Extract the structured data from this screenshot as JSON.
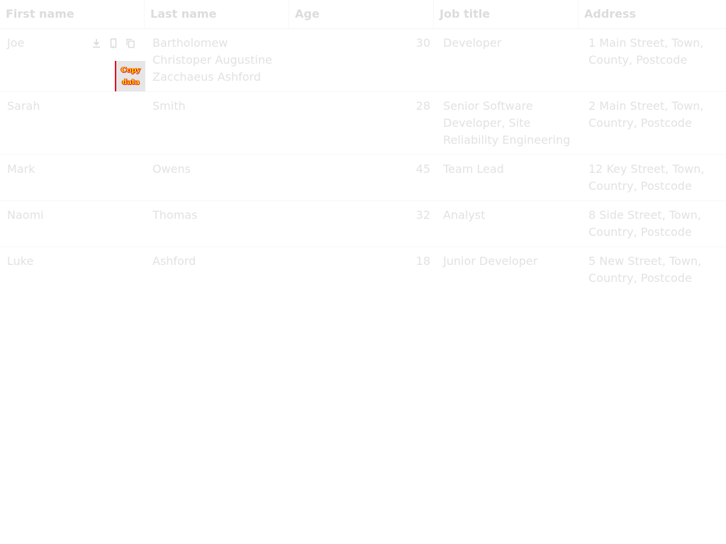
{
  "columns": [
    "First name",
    "Last name",
    "Age",
    "Job title",
    "Address"
  ],
  "rows": [
    {
      "first": "Joe",
      "last": "Bartholomew Christoper Augustine Zacchaeus Ashford",
      "age": "30",
      "job": "Developer",
      "address": "1 Main Street, Town, County, Postcode"
    },
    {
      "first": "Sarah",
      "last": "Smith",
      "age": "28",
      "job": "Senior Software Developer, Site Reliability Engineering",
      "address": "2 Main Street, Town, Country, Postcode"
    },
    {
      "first": "Mark",
      "last": "Owens",
      "age": "45",
      "job": "Team Lead",
      "address": "12 Key Street, Town, Country, Postcode"
    },
    {
      "first": "Naomi",
      "last": "Thomas",
      "age": "32",
      "job": "Analyst",
      "address": "8 Side Street, Town, Country, Postcode"
    },
    {
      "first": "Luke",
      "last": "Ashford",
      "age": "18",
      "job": "Junior Developer",
      "address": "5 New Street, Town, Country, Postcode"
    }
  ],
  "cell_tools": {
    "icons": [
      "download-icon",
      "mobile-icon",
      "copy-icon"
    ],
    "tooltip_line1": "Copy",
    "tooltip_line2": "data"
  },
  "colors": {
    "text": "#e2e2e2",
    "header_text": "#dcdcdc",
    "tooltip_bg": "#e6e6e6",
    "tooltip_text": "#ffe800",
    "tooltip_accent": "#e0001a"
  }
}
